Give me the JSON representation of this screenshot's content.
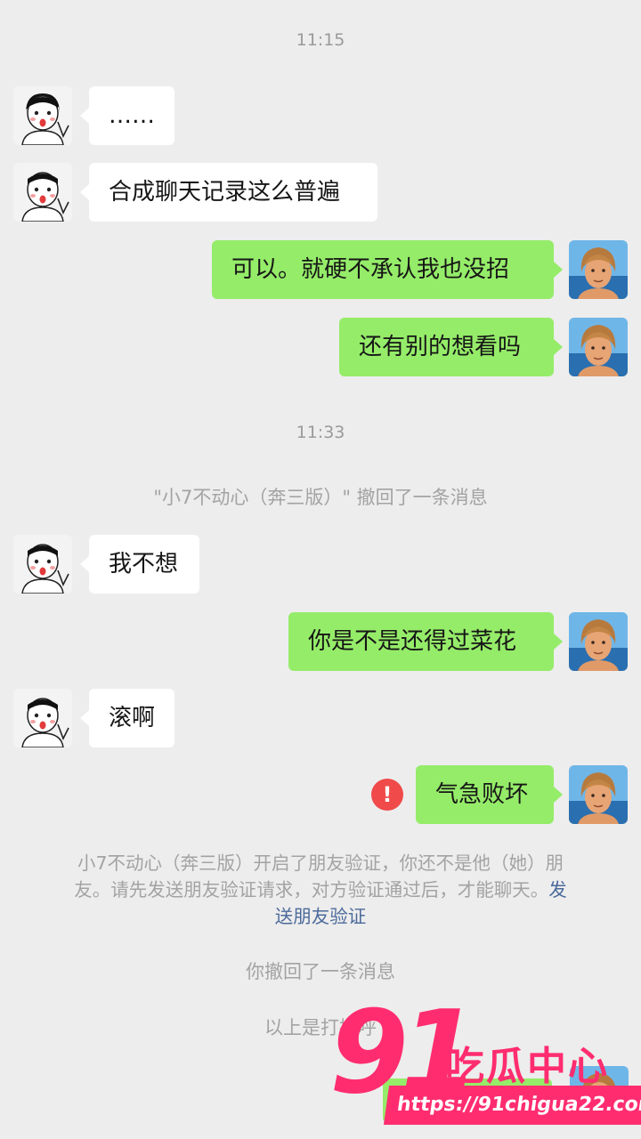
{
  "timestamps": [
    "11:15",
    "11:33"
  ],
  "messages": [
    {
      "side": "in",
      "text": "……"
    },
    {
      "side": "in",
      "text": "合成聊天记录这么普遍"
    },
    {
      "side": "out",
      "text": "可以。就硬不承认我也没招"
    },
    {
      "side": "out",
      "text": "还有别的想看吗"
    },
    {
      "side": "in",
      "text": "我不想"
    },
    {
      "side": "out",
      "text": "你是不是还得过菜花"
    },
    {
      "side": "in",
      "text": "滚啊"
    },
    {
      "side": "out",
      "text": "气急败坏",
      "failed": true
    }
  ],
  "system": {
    "recall_other": "\"小7不动心（奔三版）\" 撤回了一条消息",
    "friend_verify_line1": "小7不动心（奔三版）开启了朋友验证，你还不是他（她）朋",
    "friend_verify_line2": "友。请先发送朋友验证请求，对方验证通过后，才能聊天。",
    "friend_verify_link_a": "发",
    "friend_verify_link_b": "送朋友验证",
    "recall_self": "你撤回了一条消息",
    "above_greeting": "以上是打招呼"
  },
  "error_icon": {
    "name": "error-icon",
    "glyph": "!",
    "color": "#f04a4a"
  },
  "watermark": {
    "number": "91",
    "name": "吃瓜中心",
    "url": "https://91chigua22.com",
    "color": "#ff2d6f"
  },
  "colors": {
    "background": "#ededed",
    "bubble_in": "#ffffff",
    "bubble_out": "#95ec69"
  }
}
